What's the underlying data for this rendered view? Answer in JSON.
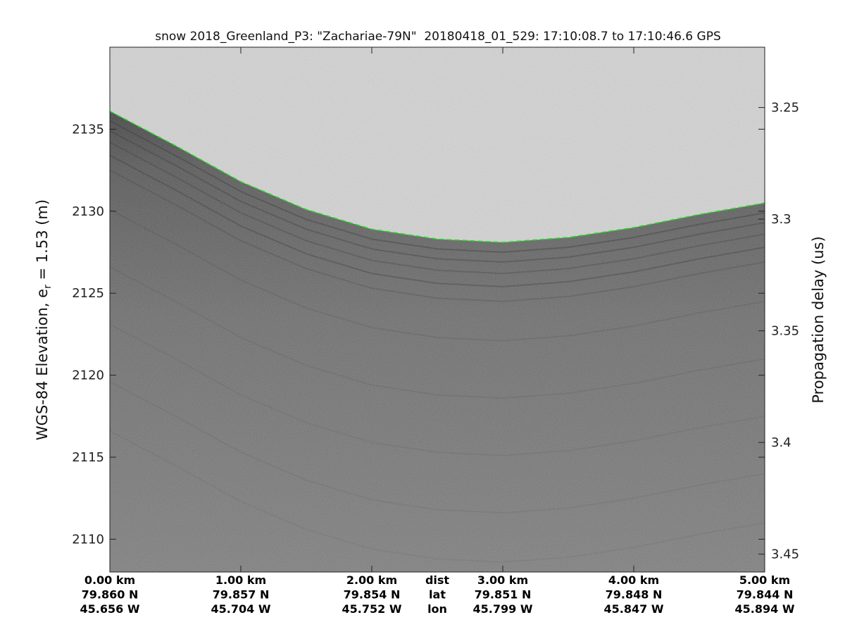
{
  "chart_data": {
    "type": "heatmap",
    "subtype": "radar-echogram",
    "title": "snow 2018_Greenland_P3: \"Zachariae-79N\"  20180418_01_529: 17:10:08.7 to 17:10:46.6 GPS",
    "ylabel_left": "WGS-84 Elevation, e",
    "ylabel_left_subscript": "r",
    "ylabel_left_suffix": " = 1.53 (m)",
    "ylabel_right": "Propagation delay (us)",
    "ylim": [
      2108,
      2140
    ],
    "yticks": [
      2110,
      2115,
      2120,
      2125,
      2130,
      2135
    ],
    "ylim_right": [
      3.223,
      3.458
    ],
    "yticks_right": [
      {
        "value": 3.25,
        "label": "3.25"
      },
      {
        "value": 3.3,
        "label": "3.3"
      },
      {
        "value": 3.35,
        "label": "3.35"
      },
      {
        "value": 3.4,
        "label": "3.4"
      },
      {
        "value": 3.45,
        "label": "3.45"
      }
    ],
    "xlim_km": [
      0,
      5
    ],
    "x_row_labels": [
      "dist",
      "lat",
      "lon"
    ],
    "xticks": [
      {
        "km": 0,
        "dist": "0.00 km",
        "lat": "79.860 N",
        "lon": "45.656 W"
      },
      {
        "km": 1,
        "dist": "1.00 km",
        "lat": "79.857 N",
        "lon": "45.704 W"
      },
      {
        "km": 2,
        "dist": "2.00 km",
        "lat": "79.854 N",
        "lon": "45.752 W"
      },
      {
        "km": 3,
        "dist": "3.00 km",
        "lat": "79.851 N",
        "lon": "45.799 W"
      },
      {
        "km": 4,
        "dist": "4.00 km",
        "lat": "79.848 N",
        "lon": "45.847 W"
      },
      {
        "km": 5,
        "dist": "5.00 km",
        "lat": "79.844 N",
        "lon": "45.894 W"
      }
    ],
    "surface_pick": {
      "color": "#22dd22",
      "style": "dashed",
      "x_km": [
        0,
        0.5,
        1.0,
        1.5,
        2.0,
        2.5,
        3.0,
        3.5,
        4.0,
        4.5,
        5.0
      ],
      "elev_m": [
        2136.1,
        2134.0,
        2131.8,
        2130.1,
        2128.9,
        2128.3,
        2128.1,
        2128.4,
        2129.0,
        2129.8,
        2130.5
      ]
    },
    "grid": false,
    "colormap": "gray"
  }
}
